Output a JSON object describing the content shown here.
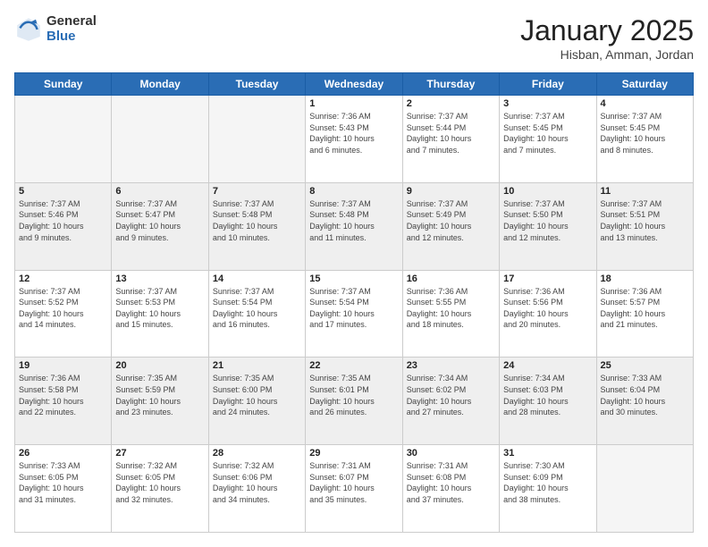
{
  "logo": {
    "general": "General",
    "blue": "Blue"
  },
  "header": {
    "month": "January 2025",
    "location": "Hisban, Amman, Jordan"
  },
  "weekdays": [
    "Sunday",
    "Monday",
    "Tuesday",
    "Wednesday",
    "Thursday",
    "Friday",
    "Saturday"
  ],
  "weeks": [
    [
      {
        "day": "",
        "info": ""
      },
      {
        "day": "",
        "info": ""
      },
      {
        "day": "",
        "info": ""
      },
      {
        "day": "1",
        "info": "Sunrise: 7:36 AM\nSunset: 5:43 PM\nDaylight: 10 hours\nand 6 minutes."
      },
      {
        "day": "2",
        "info": "Sunrise: 7:37 AM\nSunset: 5:44 PM\nDaylight: 10 hours\nand 7 minutes."
      },
      {
        "day": "3",
        "info": "Sunrise: 7:37 AM\nSunset: 5:45 PM\nDaylight: 10 hours\nand 7 minutes."
      },
      {
        "day": "4",
        "info": "Sunrise: 7:37 AM\nSunset: 5:45 PM\nDaylight: 10 hours\nand 8 minutes."
      }
    ],
    [
      {
        "day": "5",
        "info": "Sunrise: 7:37 AM\nSunset: 5:46 PM\nDaylight: 10 hours\nand 9 minutes."
      },
      {
        "day": "6",
        "info": "Sunrise: 7:37 AM\nSunset: 5:47 PM\nDaylight: 10 hours\nand 9 minutes."
      },
      {
        "day": "7",
        "info": "Sunrise: 7:37 AM\nSunset: 5:48 PM\nDaylight: 10 hours\nand 10 minutes."
      },
      {
        "day": "8",
        "info": "Sunrise: 7:37 AM\nSunset: 5:48 PM\nDaylight: 10 hours\nand 11 minutes."
      },
      {
        "day": "9",
        "info": "Sunrise: 7:37 AM\nSunset: 5:49 PM\nDaylight: 10 hours\nand 12 minutes."
      },
      {
        "day": "10",
        "info": "Sunrise: 7:37 AM\nSunset: 5:50 PM\nDaylight: 10 hours\nand 12 minutes."
      },
      {
        "day": "11",
        "info": "Sunrise: 7:37 AM\nSunset: 5:51 PM\nDaylight: 10 hours\nand 13 minutes."
      }
    ],
    [
      {
        "day": "12",
        "info": "Sunrise: 7:37 AM\nSunset: 5:52 PM\nDaylight: 10 hours\nand 14 minutes."
      },
      {
        "day": "13",
        "info": "Sunrise: 7:37 AM\nSunset: 5:53 PM\nDaylight: 10 hours\nand 15 minutes."
      },
      {
        "day": "14",
        "info": "Sunrise: 7:37 AM\nSunset: 5:54 PM\nDaylight: 10 hours\nand 16 minutes."
      },
      {
        "day": "15",
        "info": "Sunrise: 7:37 AM\nSunset: 5:54 PM\nDaylight: 10 hours\nand 17 minutes."
      },
      {
        "day": "16",
        "info": "Sunrise: 7:36 AM\nSunset: 5:55 PM\nDaylight: 10 hours\nand 18 minutes."
      },
      {
        "day": "17",
        "info": "Sunrise: 7:36 AM\nSunset: 5:56 PM\nDaylight: 10 hours\nand 20 minutes."
      },
      {
        "day": "18",
        "info": "Sunrise: 7:36 AM\nSunset: 5:57 PM\nDaylight: 10 hours\nand 21 minutes."
      }
    ],
    [
      {
        "day": "19",
        "info": "Sunrise: 7:36 AM\nSunset: 5:58 PM\nDaylight: 10 hours\nand 22 minutes."
      },
      {
        "day": "20",
        "info": "Sunrise: 7:35 AM\nSunset: 5:59 PM\nDaylight: 10 hours\nand 23 minutes."
      },
      {
        "day": "21",
        "info": "Sunrise: 7:35 AM\nSunset: 6:00 PM\nDaylight: 10 hours\nand 24 minutes."
      },
      {
        "day": "22",
        "info": "Sunrise: 7:35 AM\nSunset: 6:01 PM\nDaylight: 10 hours\nand 26 minutes."
      },
      {
        "day": "23",
        "info": "Sunrise: 7:34 AM\nSunset: 6:02 PM\nDaylight: 10 hours\nand 27 minutes."
      },
      {
        "day": "24",
        "info": "Sunrise: 7:34 AM\nSunset: 6:03 PM\nDaylight: 10 hours\nand 28 minutes."
      },
      {
        "day": "25",
        "info": "Sunrise: 7:33 AM\nSunset: 6:04 PM\nDaylight: 10 hours\nand 30 minutes."
      }
    ],
    [
      {
        "day": "26",
        "info": "Sunrise: 7:33 AM\nSunset: 6:05 PM\nDaylight: 10 hours\nand 31 minutes."
      },
      {
        "day": "27",
        "info": "Sunrise: 7:32 AM\nSunset: 6:05 PM\nDaylight: 10 hours\nand 32 minutes."
      },
      {
        "day": "28",
        "info": "Sunrise: 7:32 AM\nSunset: 6:06 PM\nDaylight: 10 hours\nand 34 minutes."
      },
      {
        "day": "29",
        "info": "Sunrise: 7:31 AM\nSunset: 6:07 PM\nDaylight: 10 hours\nand 35 minutes."
      },
      {
        "day": "30",
        "info": "Sunrise: 7:31 AM\nSunset: 6:08 PM\nDaylight: 10 hours\nand 37 minutes."
      },
      {
        "day": "31",
        "info": "Sunrise: 7:30 AM\nSunset: 6:09 PM\nDaylight: 10 hours\nand 38 minutes."
      },
      {
        "day": "",
        "info": ""
      }
    ]
  ]
}
